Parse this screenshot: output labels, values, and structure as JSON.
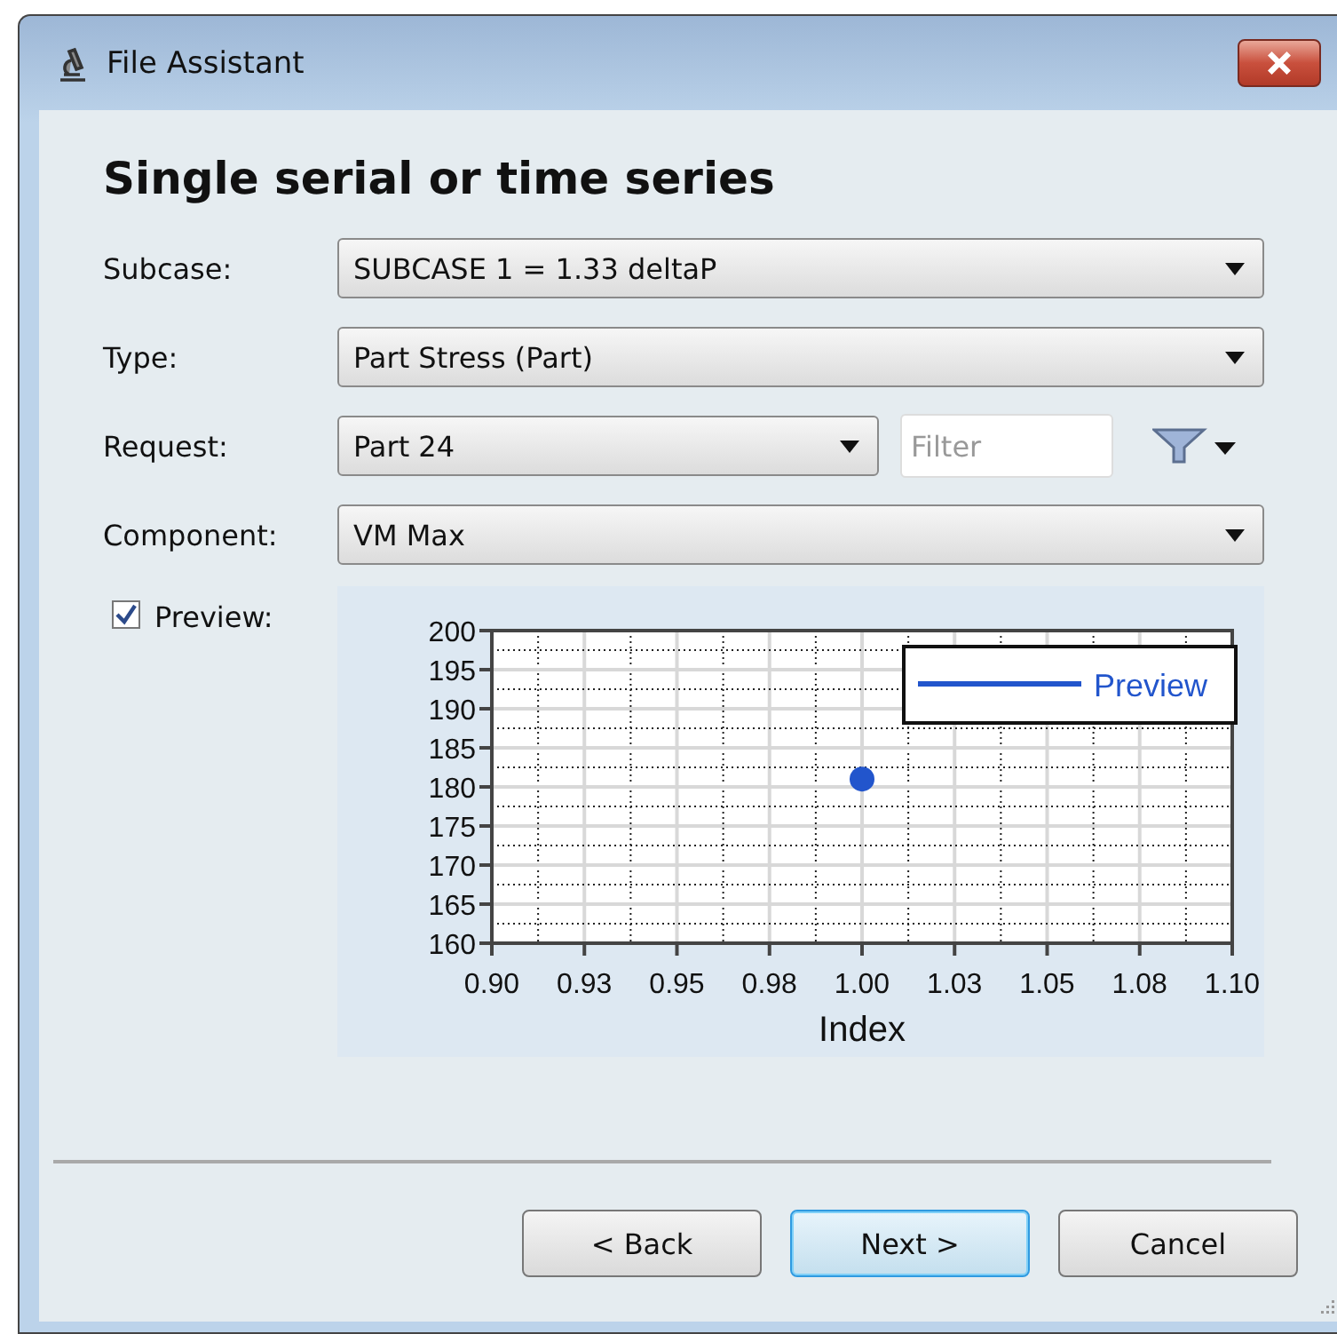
{
  "window": {
    "title": "File Assistant"
  },
  "heading": "Single serial or time series",
  "fields": [
    {
      "label": "Subcase:",
      "value": "SUBCASE 1 = 1.33 deltaP",
      "kind": "dropdown"
    },
    {
      "label": "Type:",
      "value": "Part Stress (Part)",
      "kind": "dropdown"
    },
    {
      "label": "Request:",
      "value": "Part 24",
      "kind": "dropdown-filter",
      "filter": {
        "placeholder": "Filter"
      }
    },
    {
      "label": "Component:",
      "value": "VM Max",
      "kind": "dropdown"
    }
  ],
  "preview": {
    "label": "Preview:",
    "checked": true,
    "chart_data": {
      "type": "scatter",
      "xlabel": "Index",
      "x": [
        1.0
      ],
      "series": [
        {
          "name": "Preview",
          "color": "#2255cc",
          "values": [
            181
          ]
        }
      ],
      "grid": true,
      "xlim": [
        0.9,
        1.1
      ],
      "ylim": [
        160,
        200
      ],
      "xticks": [
        {
          "value": 0.9,
          "label": "0.90"
        },
        {
          "value": 0.925,
          "label": "0.93"
        },
        {
          "value": 0.95,
          "label": "0.95"
        },
        {
          "value": 0.975,
          "label": "0.98"
        },
        {
          "value": 1.0,
          "label": "1.00"
        },
        {
          "value": 1.025,
          "label": "1.03"
        },
        {
          "value": 1.05,
          "label": "1.05"
        },
        {
          "value": 1.075,
          "label": "1.08"
        },
        {
          "value": 1.1,
          "label": "1.10"
        }
      ],
      "yticks": [
        160,
        165,
        170,
        175,
        180,
        185,
        190,
        195,
        200
      ]
    }
  },
  "buttons": [
    {
      "label": "< Back",
      "default": false
    },
    {
      "label": "Next >",
      "default": true
    },
    {
      "label": "Cancel",
      "default": false
    }
  ]
}
